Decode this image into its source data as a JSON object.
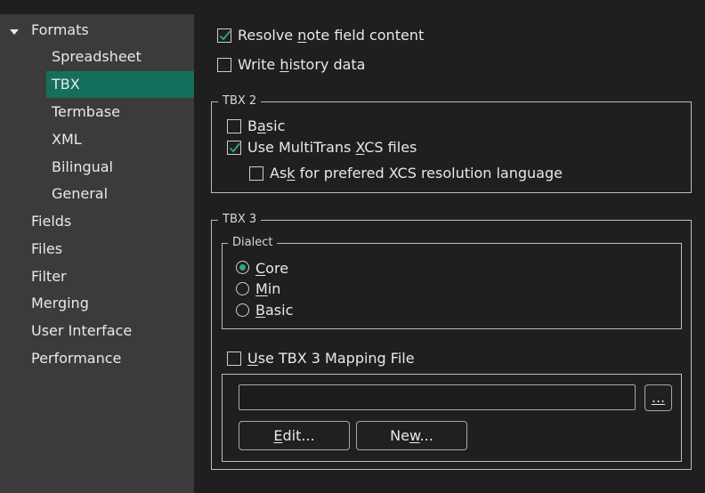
{
  "sidebar": {
    "formats_label": "Formats",
    "sub_items": [
      "Spreadsheet",
      "TBX",
      "Termbase",
      "XML",
      "Bilingual",
      "General"
    ],
    "selected": "TBX",
    "top_items": [
      "Fields",
      "Files",
      "Filter",
      "Merging",
      "User Interface",
      "Performance"
    ]
  },
  "options": {
    "resolve_note": {
      "pre": "Resolve ",
      "key": "n",
      "post": "ote field content",
      "checked": true
    },
    "write_history": {
      "pre": "Write ",
      "key": "h",
      "post": "istory data",
      "checked": false
    }
  },
  "tbx2": {
    "legend": "TBX 2",
    "basic": {
      "pre": "B",
      "key": "a",
      "post": "sic",
      "checked": false
    },
    "multitrans": {
      "pre": "Use MultiTrans ",
      "key": "X",
      "post": "CS files",
      "checked": true
    },
    "ask_lang": {
      "pre": "As",
      "key": "k",
      "post": " for prefered XCS resolution language",
      "checked": false
    }
  },
  "tbx3": {
    "legend": "TBX 3",
    "dialect_legend": "Dialect",
    "dialects": [
      {
        "key": "C",
        "post": "ore",
        "selected": true
      },
      {
        "key": "M",
        "post": "in",
        "selected": false
      },
      {
        "key": "B",
        "post": "asic",
        "selected": false
      }
    ],
    "mapping": {
      "key": "U",
      "post": "se TBX 3 Mapping File",
      "checked": false
    },
    "mapping_path": "",
    "browse_label": "...",
    "edit_button": {
      "key": "E",
      "post": "dit..."
    },
    "new_button": {
      "pre": "Ne",
      "key": "w",
      "post": "..."
    }
  },
  "colors": {
    "accent": "#2ea88a",
    "selected_bg": "#14705d",
    "sidebar_bg": "#3b3b3b",
    "page_bg": "#1f1f1f"
  }
}
